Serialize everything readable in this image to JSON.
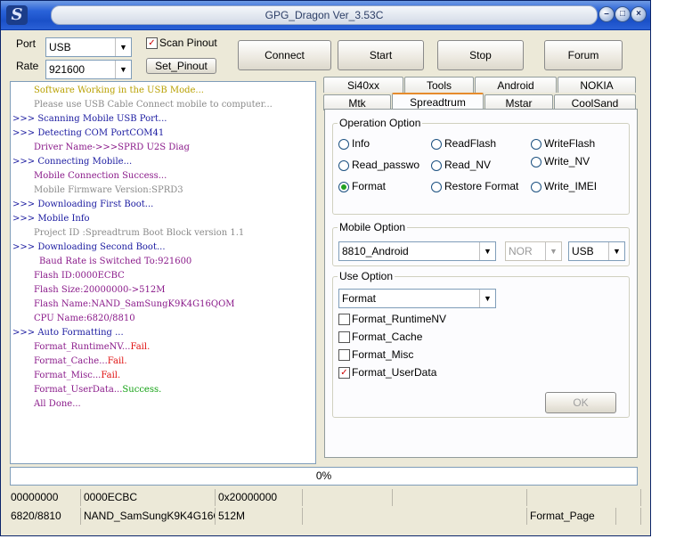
{
  "window": {
    "title": "GPG_Dragon  Ver_3.53C"
  },
  "connection": {
    "port_label": "Port",
    "port_value": "USB",
    "rate_label": "Rate",
    "rate_value": "921600",
    "scan_pinout_label": "Scan Pinout",
    "scan_pinout_checked": true,
    "set_pinout_label": "Set_Pinout"
  },
  "toolbar": {
    "connect": "Connect",
    "start": "Start",
    "stop": "Stop",
    "forum": "Forum"
  },
  "tabs_row1": [
    "Si40xx",
    "Tools",
    "Android",
    "NOKIA"
  ],
  "tabs_row2": [
    "Mtk",
    "Spreadtrum",
    "Mstar",
    "CoolSand"
  ],
  "active_tab": "Spreadtrum",
  "operation": {
    "title": "Operation Option",
    "options": [
      "Info",
      "ReadFlash",
      "WriteFlash",
      "Read_passwo",
      "Read_NV",
      "Write_NV",
      "Format",
      "Restore Format",
      "Write_IMEI"
    ],
    "selected": "Format"
  },
  "mobile": {
    "title": "Mobile Option",
    "model": "8810_Android",
    "flash_type": "NOR",
    "interface": "USB"
  },
  "use": {
    "title": "Use Option",
    "mode": "Format",
    "checks": [
      {
        "label": "Format_RuntimeNV",
        "checked": false
      },
      {
        "label": "Format_Cache",
        "checked": false
      },
      {
        "label": "Format_Misc",
        "checked": false
      },
      {
        "label": "Format_UserData",
        "checked": true
      }
    ],
    "ok_label": "OK"
  },
  "log": [
    {
      "segments": [
        {
          "text": "Software Working in the USB Mode...",
          "color": "#b8a000"
        }
      ],
      "indent": 26
    },
    {
      "segments": [
        {
          "text": "Please use USB Cable Connect mobile to computer...",
          "color": "#8a8a8a"
        }
      ],
      "indent": 26
    },
    {
      "segments": [
        {
          "text": ">>> Scanning Mobile USB Port...",
          "color": "#1a1aa0"
        }
      ],
      "indent": 2
    },
    {
      "segments": [
        {
          "text": ">>> Detecting COM PortCOM41",
          "color": "#1a1aa0"
        }
      ],
      "indent": 2
    },
    {
      "segments": [
        {
          "text": "Driver Name->>>SPRD U2S Diag",
          "color": "#8a1a8a"
        }
      ],
      "indent": 26
    },
    {
      "segments": [
        {
          "text": ">>> Connecting Mobile...",
          "color": "#1a1aa0"
        }
      ],
      "indent": 2
    },
    {
      "segments": [
        {
          "text": "Mobile Connection Success...",
          "color": "#8a1a8a"
        }
      ],
      "indent": 26
    },
    {
      "segments": [
        {
          "text": "Mobile Firmware Version:SPRD3",
          "color": "#8a8a8a"
        }
      ],
      "indent": 26
    },
    {
      "segments": [
        {
          "text": ">>> Downloading First Boot...",
          "color": "#1a1aa0"
        }
      ],
      "indent": 2
    },
    {
      "segments": [
        {
          "text": ">>> Mobile Info",
          "color": "#1a1aa0"
        }
      ],
      "indent": 2
    },
    {
      "segments": [
        {
          "text": "Project ID :Spreadtrum Boot Block version 1.1",
          "color": "#8a8a8a"
        }
      ],
      "indent": 26
    },
    {
      "segments": [
        {
          "text": ">>> Downloading Second Boot...",
          "color": "#1a1aa0"
        }
      ],
      "indent": 2
    },
    {
      "segments": [
        {
          "text": "Baud Rate is Switched To:921600",
          "color": "#8a1a8a"
        }
      ],
      "indent": 32
    },
    {
      "segments": [
        {
          "text": "Flash ID:0000ECBC",
          "color": "#8a1a8a"
        }
      ],
      "indent": 26
    },
    {
      "segments": [
        {
          "text": "Flash Size:20000000->512M",
          "color": "#8a1a8a"
        }
      ],
      "indent": 26
    },
    {
      "segments": [
        {
          "text": "Flash Name:NAND_SamSungK9K4G16QOM",
          "color": "#8a1a8a"
        }
      ],
      "indent": 26
    },
    {
      "segments": [
        {
          "text": "CPU Name:6820/8810",
          "color": "#8a1a8a"
        }
      ],
      "indent": 26
    },
    {
      "segments": [
        {
          "text": ">>> Auto Formatting ...",
          "color": "#1a1aa0"
        }
      ],
      "indent": 2
    },
    {
      "segments": [
        {
          "text": "Format_RuntimeNV...",
          "color": "#8a1a8a"
        },
        {
          "text": "Fail.",
          "color": "#e01010"
        }
      ],
      "indent": 26
    },
    {
      "segments": [
        {
          "text": "Format_Cache...",
          "color": "#8a1a8a"
        },
        {
          "text": "Fail.",
          "color": "#e01010"
        }
      ],
      "indent": 26
    },
    {
      "segments": [
        {
          "text": "Format_Misc...",
          "color": "#8a1a8a"
        },
        {
          "text": "Fail.",
          "color": "#e01010"
        }
      ],
      "indent": 26
    },
    {
      "segments": [
        {
          "text": "Format_UserData...",
          "color": "#8a1a8a"
        },
        {
          "text": "Success.",
          "color": "#10a010"
        }
      ],
      "indent": 26
    },
    {
      "segments": [
        {
          "text": "All Done...",
          "color": "#8a1a8a"
        }
      ],
      "indent": 26
    }
  ],
  "progress": {
    "percent_label": "0%",
    "value": 0
  },
  "status1": [
    "00000000",
    "0000ECBC",
    "0x20000000",
    "",
    "",
    ""
  ],
  "status2": [
    "6820/8810",
    "NAND_SamSungK9K4G16QI",
    "512M",
    "",
    "Format_Page",
    ""
  ]
}
